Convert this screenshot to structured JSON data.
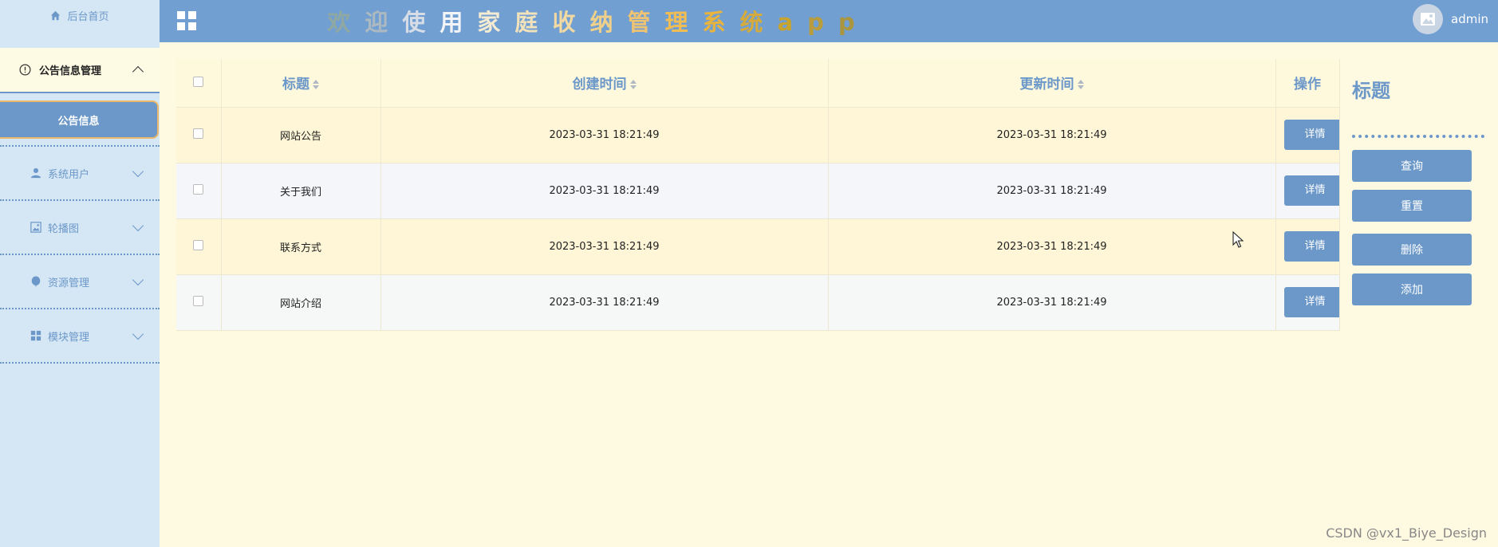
{
  "sidebar": {
    "home": {
      "label": "后台首页",
      "icon": "home-icon"
    },
    "open_group": {
      "label": "公告信息管理",
      "icon": "info-circle-icon",
      "sub_items": [
        {
          "label": "公告信息"
        }
      ]
    },
    "menus": [
      {
        "label": "系统用户",
        "icon": "user-icon"
      },
      {
        "label": "轮播图",
        "icon": "image-icon"
      },
      {
        "label": "资源管理",
        "icon": "balloon-icon"
      },
      {
        "label": "模块管理",
        "icon": "grid-icon"
      }
    ]
  },
  "header": {
    "title_chars": [
      "欢",
      "迎",
      "使",
      "用",
      "家",
      "庭",
      "收",
      "纳",
      "管",
      "理",
      "系",
      "统",
      "a",
      "p",
      "p"
    ],
    "title_colors": [
      "#8fa8a2",
      "#adb9c0",
      "#d6dde6",
      "#f2f4f7",
      "#f4ebd2",
      "#f1e2bb",
      "#f0d9a2",
      "#efd08b",
      "#eec373",
      "#f0bd55",
      "#e9b43e",
      "#d4ab3c",
      "#c7a42e",
      "#b99c3c",
      "#a9963f"
    ],
    "user": "admin"
  },
  "table": {
    "columns": [
      "标题",
      "创建时间",
      "更新时间",
      "操作"
    ],
    "rows": [
      {
        "title": "网站公告",
        "created": "2023-03-31 18:21:49",
        "updated": "2023-03-31 18:21:49",
        "action": "详情"
      },
      {
        "title": "关于我们",
        "created": "2023-03-31 18:21:49",
        "updated": "2023-03-31 18:21:49",
        "action": "详情"
      },
      {
        "title": "联系方式",
        "created": "2023-03-31 18:21:49",
        "updated": "2023-03-31 18:21:49",
        "action": "详情"
      },
      {
        "title": "网站介绍",
        "created": "2023-03-31 18:21:49",
        "updated": "2023-03-31 18:21:49",
        "action": "详情"
      }
    ]
  },
  "search_panel": {
    "title": "标题",
    "buttons": {
      "query": "查询",
      "reset": "重置",
      "delete": "删除",
      "add": "添加"
    }
  },
  "watermark": "CSDN @vx1_Biye_Design",
  "colors": {
    "accent": "#6c98c9",
    "header_bg": "#719fd2",
    "sidebar_bg": "#d5e6f5",
    "content_bg": "#fef9e1"
  }
}
